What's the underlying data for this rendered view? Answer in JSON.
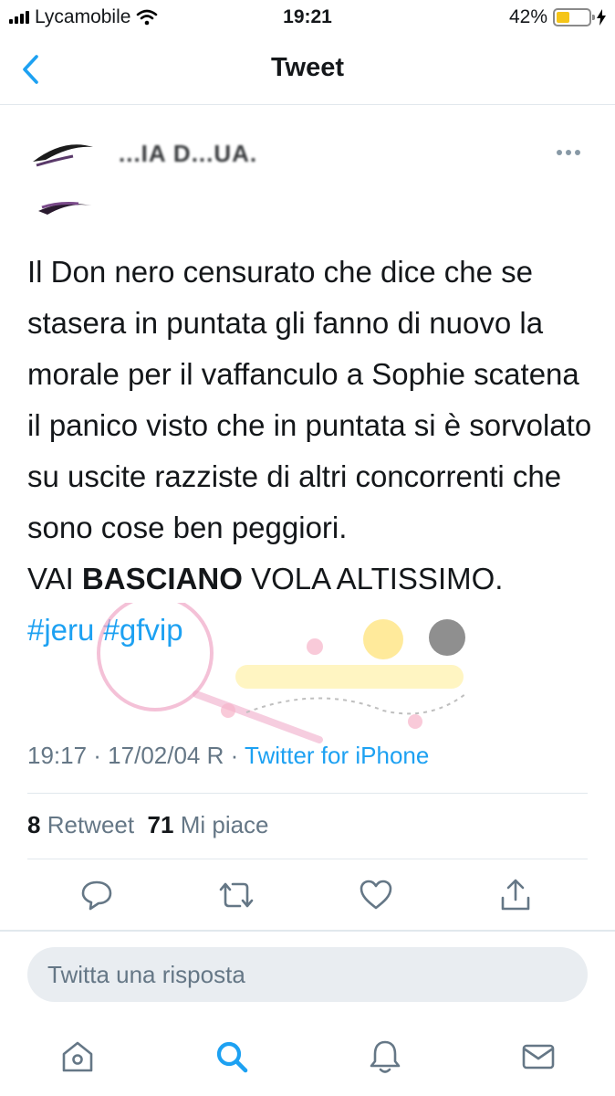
{
  "status_bar": {
    "carrier": "Lycamobile",
    "time": "19:21",
    "battery_percent": "42%",
    "battery_level": 0.42,
    "battery_color": "#f5c518"
  },
  "nav": {
    "title": "Tweet",
    "back_icon": "chevron-left-icon"
  },
  "tweet": {
    "author_name": "...IA D...UA.",
    "more_icon": "more-horizontal-icon",
    "text_lines": [
      "Il Don nero censurato che dice che se stasera in puntata gli fanno di nuovo la morale per il vaffanculo a Sophie scatena il panico visto che in puntata si è sorvolato su uscite razziste di altri concorrenti che sono cose ben peggiori."
    ],
    "line2_prefix": "VAI ",
    "line2_bold": "BASCIANO",
    "line2_suffix": " VOLA ALTISSIMO.",
    "hashtags": [
      "#jeru",
      "#gfvip"
    ],
    "timestamp": "19:17 · 17/02/04 R · ",
    "source": "Twitter for iPhone",
    "retweets_count": "8",
    "retweets_label": "Retweet",
    "likes_count": "71",
    "likes_label": "Mi piace"
  },
  "actions": {
    "reply_icon": "reply-icon",
    "retweet_icon": "retweet-icon",
    "like_icon": "heart-icon",
    "share_icon": "share-icon"
  },
  "reply_box": {
    "placeholder": "Twitta una risposta"
  },
  "tab_bar": {
    "items": [
      "home-icon",
      "search-icon",
      "notifications-icon",
      "messages-icon"
    ],
    "active": "search-icon"
  },
  "colors": {
    "accent": "#1da1f2",
    "muted": "#657786",
    "divider": "#e1e8ed"
  }
}
